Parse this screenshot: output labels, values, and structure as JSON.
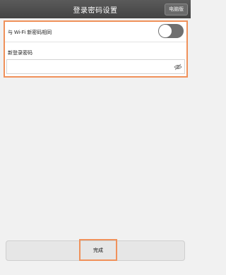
{
  "header": {
    "title": "登录密码设置",
    "pc_version_label": "电脑版"
  },
  "form": {
    "wifi_same_label": "与 Wi-Fi 新密码相同",
    "wifi_same_toggle": "off",
    "new_password_label": "新登录密码",
    "new_password_value": "",
    "eye_icon": "eye-icon"
  },
  "footer": {
    "done_label": "完成"
  },
  "colors": {
    "highlight": "#f0915a",
    "titlebar": "#4a4a4a",
    "toggle_track": "#6f6f6f"
  }
}
